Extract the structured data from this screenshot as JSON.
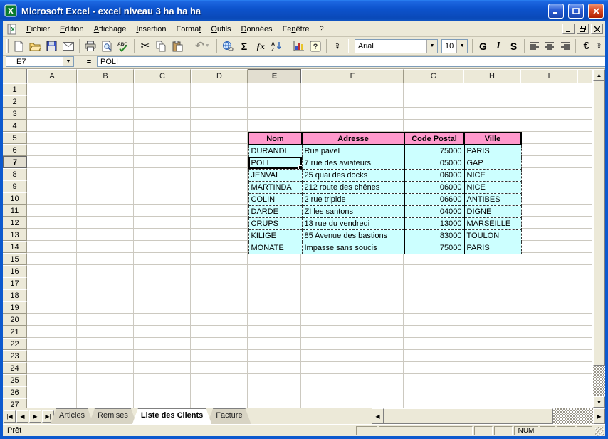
{
  "window": {
    "title": "Microsoft Excel - excel niveau 3 ha ha ha",
    "controls": [
      "minimize",
      "maximize",
      "close"
    ]
  },
  "menu_bar": {
    "items": [
      {
        "label": "Fichier",
        "accel": 0
      },
      {
        "label": "Edition",
        "accel": 0
      },
      {
        "label": "Affichage",
        "accel": 0
      },
      {
        "label": "Insertion",
        "accel": 0
      },
      {
        "label": "Format",
        "accel": 5
      },
      {
        "label": "Outils",
        "accel": 0
      },
      {
        "label": "Données",
        "accel": 0
      },
      {
        "label": "Fenêtre",
        "accel": 2
      },
      {
        "label": "?",
        "accel": -1
      }
    ],
    "workbook_controls": [
      "minimize",
      "restore",
      "close"
    ]
  },
  "toolbar": {
    "standard_groups": [
      [
        "new",
        "open",
        "save",
        "email"
      ],
      [
        "print",
        "print-preview",
        "spelling"
      ],
      [
        "cut",
        "copy",
        "paste"
      ],
      [
        "undo"
      ],
      [
        "hyperlink",
        "autosum",
        "function",
        "sort-asc"
      ],
      [
        "chart",
        "help"
      ],
      [
        "more"
      ]
    ],
    "disabled_buttons": [
      "undo"
    ],
    "font_name": "Arial",
    "font_size": "10",
    "glyphs": {
      "cut": "✂",
      "undo": "↶",
      "autosum": "Σ",
      "function": "ƒx",
      "help": "?",
      "more": "»",
      "bold": "G",
      "italic": "I",
      "underline": "S",
      "euro": "€"
    }
  },
  "formula_bar": {
    "cell_ref": "E7",
    "equals_label": "=",
    "value": "POLI"
  },
  "grid": {
    "columns": [
      "A",
      "B",
      "C",
      "D",
      "E",
      "F",
      "G",
      "H",
      "I"
    ],
    "row_count": 27,
    "active_column": "E",
    "active_row": 7
  },
  "worksheet_table": {
    "origin_cell": "E5",
    "header_bg": "#FF99CC",
    "cell_bg": "#CCFFFF",
    "headers": [
      "Nom",
      "Adresse",
      "Code Postal",
      "Ville"
    ],
    "rows": [
      [
        "DURANDI",
        "Rue pavel",
        "75000",
        "PARIS"
      ],
      [
        "POLI",
        "7 rue des aviateurs",
        "05000",
        "GAP"
      ],
      [
        "JENVAL",
        "25 quai des docks",
        "06000",
        "NICE"
      ],
      [
        "MARTINDA",
        "212 route des chênes",
        "06000",
        "NICE"
      ],
      [
        "COLIN",
        "2 rue tripide",
        "06600",
        "ANTIBES"
      ],
      [
        "DARDE",
        "ZI les santons",
        "04000",
        "DIGNE"
      ],
      [
        "CRUPS",
        "13 rue du vendredi",
        "13000",
        "MARSEILLE"
      ],
      [
        "KILIGE",
        "85 Avenue des bastions",
        "83000",
        "TOULON"
      ],
      [
        "MONATE",
        "Impasse sans soucis",
        "75000",
        "PARIS"
      ]
    ],
    "selected_cell": {
      "ref": "E7",
      "row_index": 1,
      "col_index": 0,
      "value": "POLI"
    }
  },
  "sheet_tabs": {
    "tabs": [
      "Articles",
      "Remises",
      "Liste des Clients",
      "Facture"
    ],
    "active": "Liste des Clients"
  },
  "status_bar": {
    "ready_label": "Prêt",
    "panels": [
      "",
      "",
      "",
      "",
      "NUM",
      "",
      "",
      ""
    ]
  },
  "colors": {
    "titlebar_blue": "#0D53CD",
    "chrome": "#ECE9D8",
    "gridline": "#CCC9C0",
    "table_header_pink": "#FF99CC",
    "table_cell_cyan": "#CCFFFF"
  }
}
